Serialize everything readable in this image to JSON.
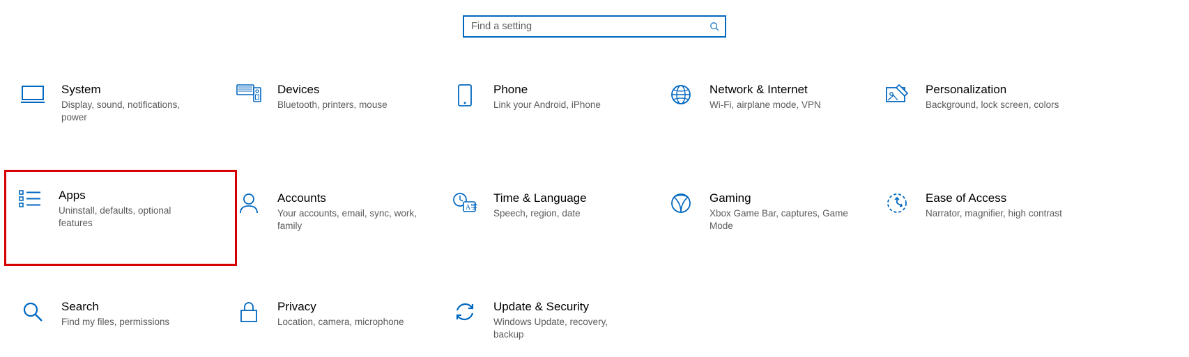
{
  "search": {
    "placeholder": "Find a setting"
  },
  "tiles": {
    "system": {
      "title": "System",
      "desc": "Display, sound, notifications, power"
    },
    "devices": {
      "title": "Devices",
      "desc": "Bluetooth, printers, mouse"
    },
    "phone": {
      "title": "Phone",
      "desc": "Link your Android, iPhone"
    },
    "network": {
      "title": "Network & Internet",
      "desc": "Wi-Fi, airplane mode, VPN"
    },
    "personal": {
      "title": "Personalization",
      "desc": "Background, lock screen, colors"
    },
    "apps": {
      "title": "Apps",
      "desc": "Uninstall, defaults, optional features"
    },
    "accounts": {
      "title": "Accounts",
      "desc": "Your accounts, email, sync, work, family"
    },
    "time": {
      "title": "Time & Language",
      "desc": "Speech, region, date"
    },
    "gaming": {
      "title": "Gaming",
      "desc": "Xbox Game Bar, captures, Game Mode"
    },
    "ease": {
      "title": "Ease of Access",
      "desc": "Narrator, magnifier, high contrast"
    },
    "searchcat": {
      "title": "Search",
      "desc": "Find my files, permissions"
    },
    "privacy": {
      "title": "Privacy",
      "desc": "Location, camera, microphone"
    },
    "update": {
      "title": "Update & Security",
      "desc": "Windows Update, recovery, backup"
    }
  },
  "highlight": "apps"
}
